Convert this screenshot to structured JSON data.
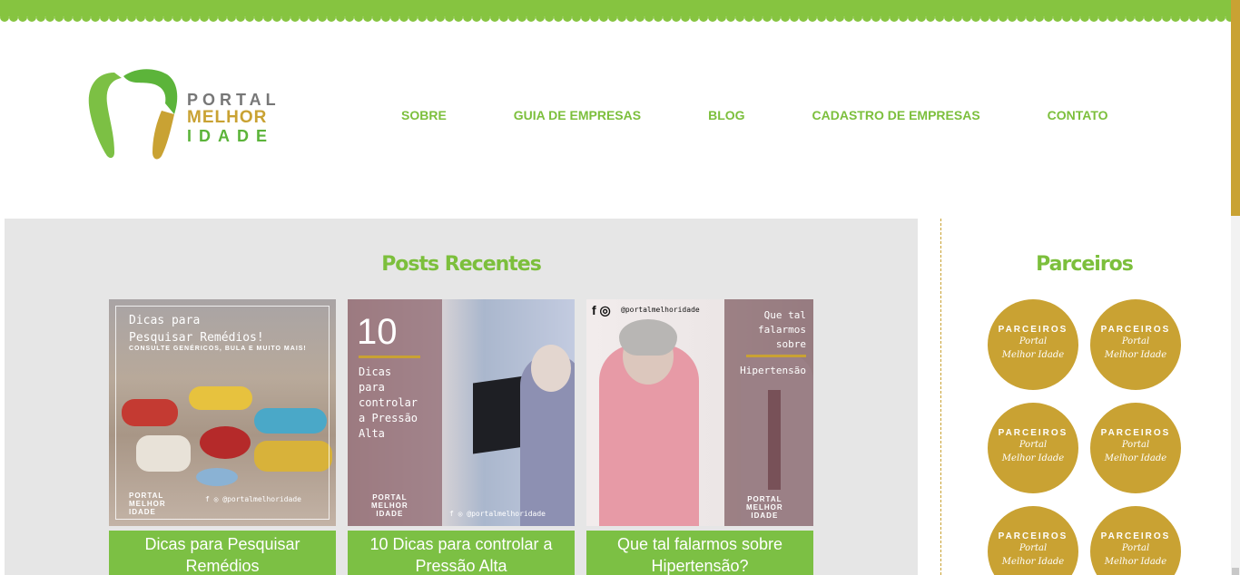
{
  "site": {
    "logo_line1": "PORTAL",
    "logo_line2": "MELHOR",
    "logo_line3": "IDADE",
    "colors": {
      "green": "#7cbf3c",
      "gold": "#c9a233",
      "gray_panel": "#e6e6e6"
    }
  },
  "nav": {
    "items": [
      {
        "label": "SOBRE"
      },
      {
        "label": "GUIA DE EMPRESAS"
      },
      {
        "label": "BLOG"
      },
      {
        "label": "CADASTRO DE EMPRESAS"
      },
      {
        "label": "CONTATO"
      }
    ]
  },
  "recent_posts": {
    "title": "Posts Recentes",
    "posts": [
      {
        "caption": "Dicas para Pesquisar Remédios",
        "thumb_title_1": "Dicas para",
        "thumb_title_2": "Pesquisar Remédios!",
        "thumb_sub": "CONSULTE GENÉRICOS, BULA E MUITO MAIS!",
        "brand_1": "PORTAL",
        "brand_2": "MELHOR",
        "brand_3": "IDADE",
        "social": "f ◎",
        "handle": "@portalmelhoridade"
      },
      {
        "caption": "10 Dicas para controlar a Pressão Alta",
        "thumb_num": "10",
        "thumb_line_1": "Dicas",
        "thumb_line_2": "para",
        "thumb_line_3": "controlar",
        "thumb_line_4": "a Pressão",
        "thumb_line_5": "Alta",
        "brand_1": "PORTAL",
        "brand_2": "MELHOR",
        "brand_3": "IDADE",
        "social": "f ◎",
        "handle": "@portalmelhoridade"
      },
      {
        "caption": "Que tal falarmos sobre Hipertensão?",
        "thumb_line_1": "Que tal",
        "thumb_line_2": "falarmos",
        "thumb_line_3": "sobre",
        "thumb_hyper": "Hipertensão",
        "brand_1": "PORTAL",
        "brand_2": "MELHOR",
        "brand_3": "IDADE",
        "social": "f ◎",
        "handle": "@portalmelhoridade"
      }
    ]
  },
  "partners": {
    "title": "Parceiros",
    "badges": [
      {
        "line1": "PARCEIROS",
        "line2": "Portal",
        "line3": "Melhor Idade"
      },
      {
        "line1": "PARCEIROS",
        "line2": "Portal",
        "line3": "Melhor Idade"
      },
      {
        "line1": "PARCEIROS",
        "line2": "Portal",
        "line3": "Melhor Idade"
      },
      {
        "line1": "PARCEIROS",
        "line2": "Portal",
        "line3": "Melhor Idade"
      },
      {
        "line1": "PARCEIROS",
        "line2": "Portal",
        "line3": "Melhor Idade"
      },
      {
        "line1": "PARCEIROS",
        "line2": "Portal",
        "line3": "Melhor Idade"
      }
    ]
  }
}
